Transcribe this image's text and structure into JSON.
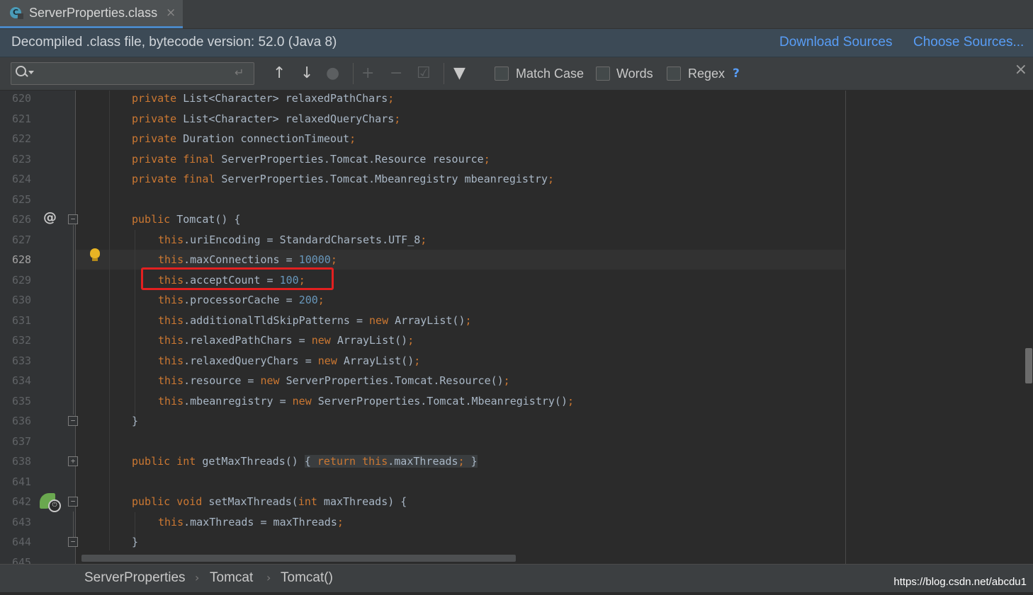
{
  "tab": {
    "title": "ServerProperties.class",
    "icon": "class-file-icon",
    "close": "×"
  },
  "banner": {
    "message": "Decompiled .class file, bytecode version: 52.0 (Java 8)",
    "download_sources": "Download Sources",
    "choose_sources": "Choose Sources..."
  },
  "search": {
    "value": "",
    "placeholder": "",
    "enter_glyph": "↵",
    "match_case": "Match Case",
    "words": "Words",
    "regex": "Regex",
    "help": "?",
    "close": "×"
  },
  "line_numbers": [
    "620",
    "621",
    "622",
    "623",
    "624",
    "625",
    "626",
    "627",
    "628",
    "629",
    "630",
    "631",
    "632",
    "633",
    "634",
    "635",
    "636",
    "637",
    "638",
    "641",
    "642",
    "643",
    "644",
    "645"
  ],
  "current_line": "628",
  "breadcrumb": [
    "ServerProperties",
    "Tomcat",
    "Tomcat()"
  ],
  "breadcrumb_sep": "›",
  "watermark": "https://blog.csdn.net/abcdu1",
  "colors": {
    "keyword": "#cc7832",
    "number": "#6897bb",
    "text": "#a9b7c6",
    "link": "#589df6",
    "highlight_box": "#e22020"
  }
}
